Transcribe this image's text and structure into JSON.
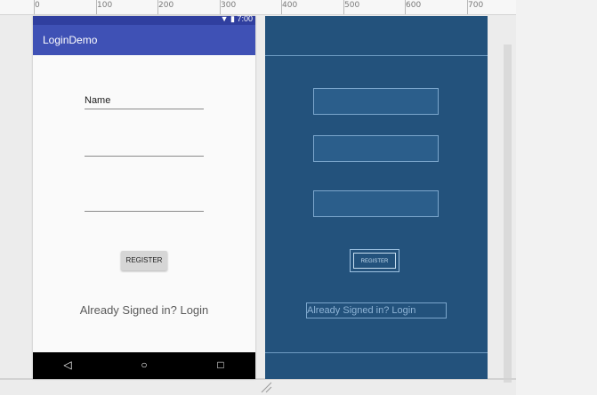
{
  "ruler": {
    "labels": [
      "0",
      "100",
      "200",
      "300",
      "400",
      "500",
      "600",
      "700"
    ]
  },
  "device": {
    "status_time": "7:00",
    "app_title": "LoginDemo",
    "fields": [
      {
        "value": "Name"
      },
      {
        "value": ""
      },
      {
        "value": ""
      }
    ],
    "register_label": "REGISTER",
    "login_link": "Already Signed in? Login",
    "nav_icons": [
      "back-icon",
      "home-icon",
      "recents-icon"
    ]
  },
  "blueprint": {
    "register_label": "REGISTER",
    "login_link": "Already Signed in? Login"
  },
  "colors": {
    "primary": "#3f51b5",
    "primary_dark": "#303f9f",
    "blueprint_bg": "#23527c"
  }
}
